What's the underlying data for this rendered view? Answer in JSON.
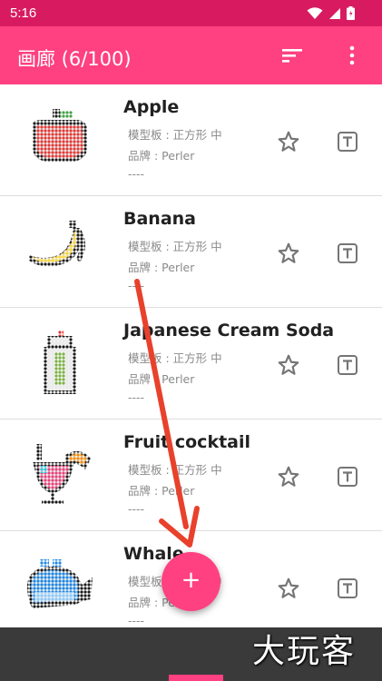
{
  "status_bar": {
    "time": "5:16"
  },
  "app_bar": {
    "title": "画廊 (6/100)"
  },
  "items": [
    {
      "name": "Apple",
      "template": "模型板 : 正方形 中",
      "brand": "品牌 : Perler",
      "extra": "----"
    },
    {
      "name": "Banana",
      "template": "模型板 : 正方形 中",
      "brand": "品牌 : Perler",
      "extra": "----"
    },
    {
      "name": "Japanese Cream Soda",
      "template": "模型板 : 正方形 中",
      "brand": "品牌 : Perler",
      "extra": "----"
    },
    {
      "name": "Fruit cocktail",
      "template": "模型板 : 正方形 中",
      "brand": "品牌 : Perler",
      "extra": "----"
    },
    {
      "name": "Whale",
      "template": "模型板 : 正方形 中",
      "brand": "品牌 : Perler",
      "extra": "----"
    }
  ],
  "fab": {
    "label": "+"
  },
  "watermark": "大玩客",
  "colors": {
    "primary": "#ff4081",
    "status": "#d81b60",
    "annotation_arrow": "#e8412c"
  },
  "icons": [
    "wifi-icon",
    "signal-icon",
    "battery-icon",
    "sort-icon",
    "more-vert-icon",
    "star-outline-icon",
    "text-icon",
    "add-icon"
  ]
}
